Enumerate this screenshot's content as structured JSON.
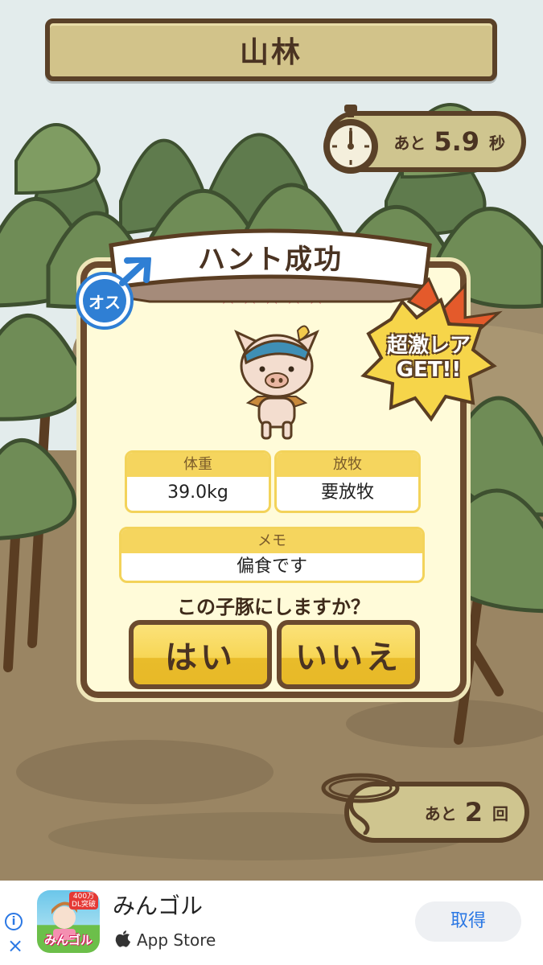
{
  "location_title": "山林",
  "timer": {
    "prefix": "あと",
    "value": "5.9",
    "unit": "秒"
  },
  "result": {
    "title": "ハント成功",
    "gender_badge": "オス",
    "stars": "★★★★★",
    "rarity_burst": {
      "line1": "超激レア",
      "line2": "GET!!"
    },
    "weight_label": "体重",
    "weight_value": "39.0kg",
    "graze_label": "放牧",
    "graze_value": "要放牧",
    "memo_label": "メモ",
    "memo_value": "偏食です",
    "question": "この子豚にしますか？",
    "yes_label": "はい",
    "no_label": "いいえ"
  },
  "remaining": {
    "prefix": "あと",
    "value": "2",
    "unit": "回"
  },
  "ad": {
    "app_name": "みんゴル",
    "store_label": "App Store",
    "get_label": "取得",
    "icon_badge": "400万DL突破",
    "icon_text": "みんゴル"
  },
  "colors": {
    "accent_yellow": "#f5d55e",
    "wood_border": "#6b4a2e",
    "star_pink": "#e77c86",
    "male_blue": "#2f7fd4"
  }
}
